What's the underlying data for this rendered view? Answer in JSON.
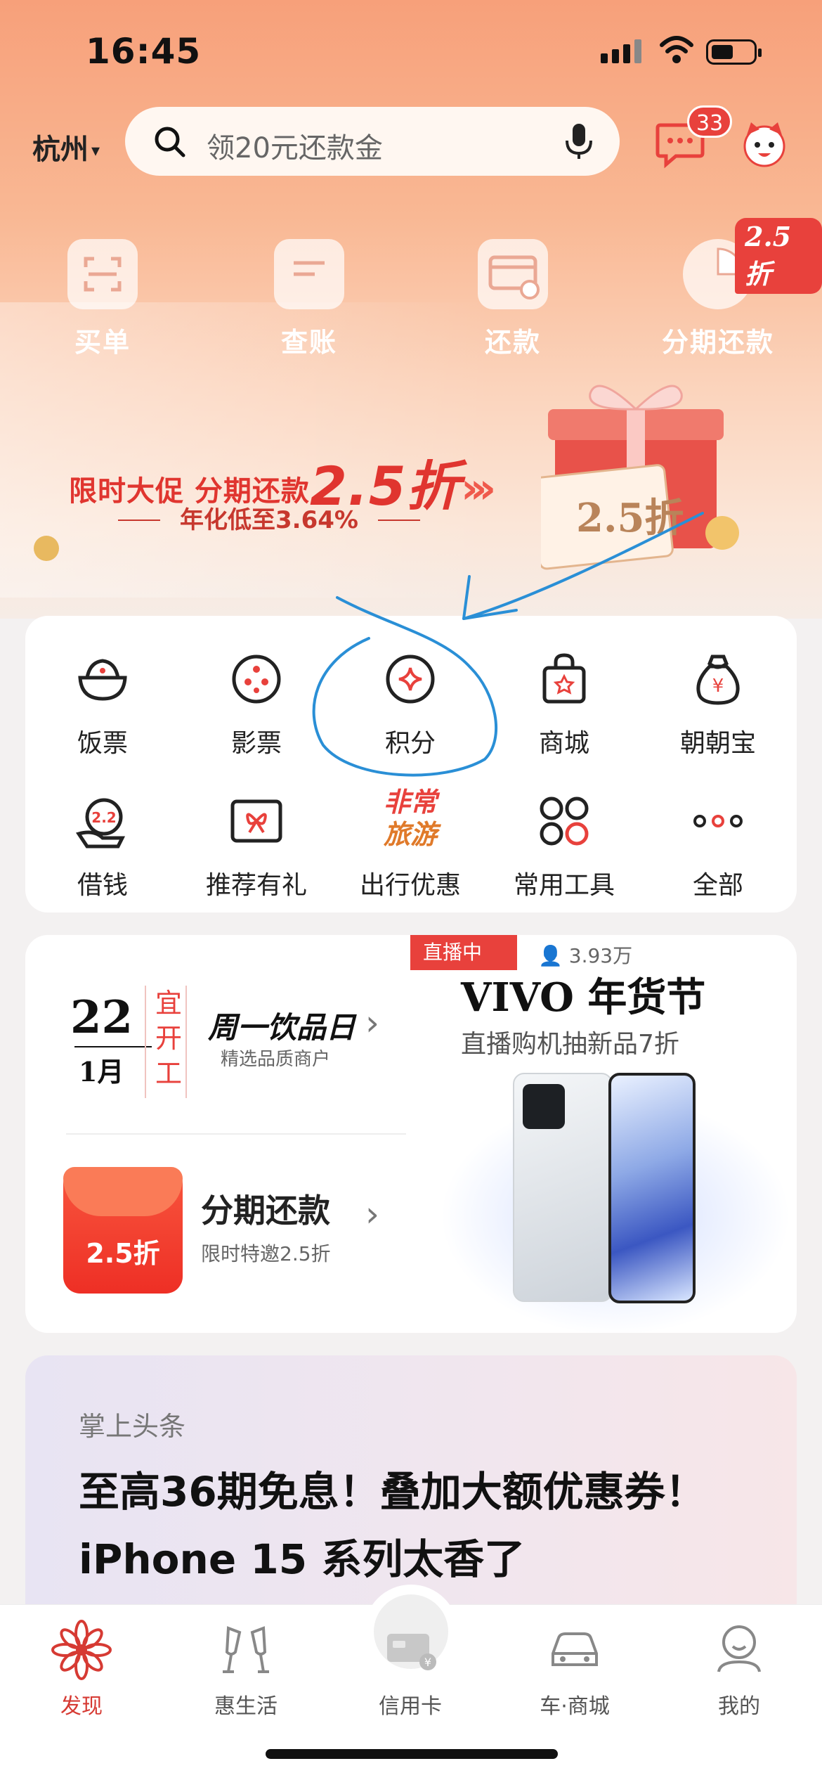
{
  "status_bar": {
    "time": "16:45"
  },
  "header": {
    "city": "杭州",
    "search_placeholder": "领20元还款金",
    "message_count": "33"
  },
  "quick_actions": [
    {
      "label": "买单",
      "icon": "scan-icon"
    },
    {
      "label": "查账",
      "icon": "bill-icon"
    },
    {
      "label": "还款",
      "icon": "repay-card-icon"
    },
    {
      "label": "分期还款",
      "icon": "pie-chart-icon"
    }
  ],
  "quick_badge": "2.5折",
  "banner": {
    "title": "限时大促 分期还款",
    "title_big": "2.5折",
    "subtitle": "年化低至3.64%",
    "gift_label": "2.5折"
  },
  "grid": [
    {
      "label": "饭票",
      "icon": "rice-bowl-icon"
    },
    {
      "label": "影票",
      "icon": "film-reel-icon"
    },
    {
      "label": "积分",
      "icon": "points-icon"
    },
    {
      "label": "商城",
      "icon": "shopping-bag-icon"
    },
    {
      "label": "朝朝宝",
      "icon": "money-bag-icon"
    },
    {
      "label": "借钱",
      "icon": "loan-hand-icon"
    },
    {
      "label": "推荐有礼",
      "icon": "gift-card-icon"
    },
    {
      "label": "出行优惠",
      "icon": "travel-icon"
    },
    {
      "label": "常用工具",
      "icon": "tools-icon"
    },
    {
      "label": "全部",
      "icon": "more-icon"
    }
  ],
  "travel_icon_text": [
    "非常",
    "旅游"
  ],
  "loan_icon_text": "2.2",
  "calendar": {
    "day": "22",
    "month": "1月",
    "almanac": [
      "宜",
      "开",
      "工"
    ],
    "title": "周一饮品日",
    "subtitle": "精选品质商户"
  },
  "installment": {
    "title": "分期还款",
    "subtitle": "限时特邀2.5折",
    "envelope_label": "2.5折"
  },
  "live": {
    "tag": "直播中",
    "viewers": "3.93万",
    "title": "VIVO 年货节",
    "subtitle": "直播购机抽新品7折"
  },
  "news": {
    "tag": "掌上头条",
    "title": "至高36期免息！叠加大额优惠券！iPhone 15 系列太香了"
  },
  "tabbar": [
    {
      "label": "发现",
      "icon": "discover-flower-icon",
      "active": true
    },
    {
      "label": "惠生活",
      "icon": "cheers-icon",
      "active": false
    },
    {
      "label": "信用卡",
      "icon": "credit-card-icon",
      "active": false
    },
    {
      "label": "车·商城",
      "icon": "car-icon",
      "active": false
    },
    {
      "label": "我的",
      "icon": "profile-icon",
      "active": false
    }
  ],
  "colors": {
    "accent": "#e8413c",
    "annotation": "#2a8fd6"
  }
}
